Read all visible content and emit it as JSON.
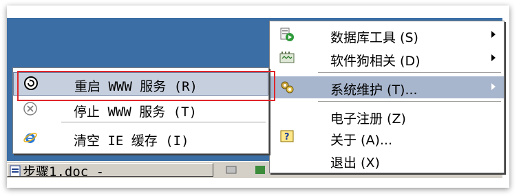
{
  "main_menu": {
    "items": [
      {
        "label": "数据库工具 (S)",
        "icon": "database-tool-icon",
        "has_submenu": true
      },
      {
        "label": "软件狗相关 (D)",
        "icon": "dongle-icon",
        "has_submenu": true
      },
      {
        "label": "系统维护 (T)...",
        "icon": "gears-icon",
        "has_submenu": true,
        "highlighted": true
      },
      {
        "label": "电子注册 (Z)",
        "icon": "",
        "has_submenu": false
      },
      {
        "label": "关于 (A)...",
        "icon": "help-icon",
        "has_submenu": false
      },
      {
        "label": "退出 (X)",
        "icon": "",
        "has_submenu": false
      }
    ]
  },
  "sub_menu": {
    "items": [
      {
        "label": "重启 WWW 服务 (R)",
        "icon": "restart-icon",
        "highlighted": true
      },
      {
        "label": "停止 WWW 服务 (T)",
        "icon": "stop-icon"
      },
      {
        "label": "清空 IE 缓存 (I)",
        "icon": "ie-icon"
      }
    ]
  },
  "taskbar": {
    "item_label": "步骤1.doc -"
  },
  "colors": {
    "highlight": "#a8b6cd",
    "annotation_box": "#e0262a",
    "desktop": "#3a6ea5"
  }
}
